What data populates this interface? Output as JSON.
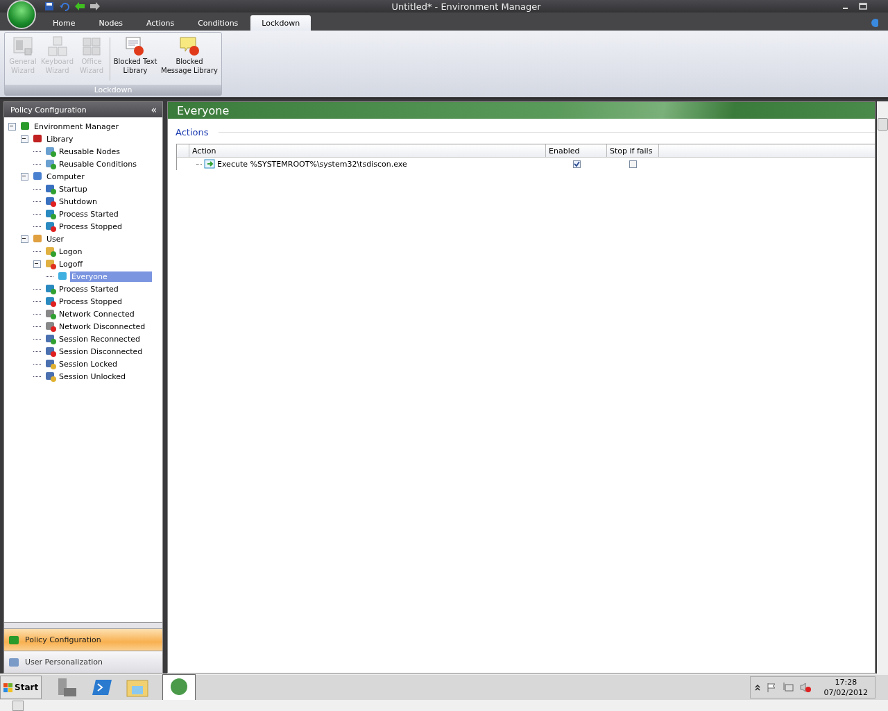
{
  "window": {
    "title": "Untitled* - Environment Manager"
  },
  "ribbon_tabs": [
    {
      "label": "Home",
      "selected": false
    },
    {
      "label": "Nodes",
      "selected": false
    },
    {
      "label": "Actions",
      "selected": false
    },
    {
      "label": "Conditions",
      "selected": false
    },
    {
      "label": "Lockdown",
      "selected": true
    }
  ],
  "ribbon_group": {
    "label": "Lockdown",
    "buttons": [
      {
        "label": "General Wizard",
        "disabled": true,
        "kind": "general"
      },
      {
        "label": "Keyboard Wizard",
        "disabled": true,
        "kind": "keyboard"
      },
      {
        "label": "Office Wizard",
        "disabled": true,
        "kind": "office"
      },
      {
        "label": "Blocked Text Library",
        "disabled": false,
        "kind": "text"
      },
      {
        "label": "Blocked Message Library",
        "disabled": false,
        "kind": "message"
      }
    ]
  },
  "sidebar": {
    "title": "Policy Configuration",
    "collapse": "«",
    "tree": [
      {
        "label": "Environment Manager",
        "kind": "root",
        "expanded": true,
        "selected": false,
        "children": [
          {
            "label": "Library",
            "kind": "library",
            "expanded": true,
            "selected": false,
            "children": [
              {
                "label": "Reusable Nodes",
                "kind": "reusable",
                "selected": false
              },
              {
                "label": "Reusable Conditions",
                "kind": "reusable",
                "selected": false
              }
            ]
          },
          {
            "label": "Computer",
            "kind": "computer",
            "expanded": true,
            "selected": false,
            "children": [
              {
                "label": "Startup",
                "kind": "startup",
                "selected": false
              },
              {
                "label": "Shutdown",
                "kind": "shutdown",
                "selected": false
              },
              {
                "label": "Process Started",
                "kind": "process-start",
                "selected": false
              },
              {
                "label": "Process Stopped",
                "kind": "process-stop",
                "selected": false
              }
            ]
          },
          {
            "label": "User",
            "kind": "user",
            "expanded": true,
            "selected": false,
            "children": [
              {
                "label": "Logon",
                "kind": "logon",
                "selected": false
              },
              {
                "label": "Logoff",
                "kind": "logoff",
                "expanded": true,
                "selected": false,
                "children": [
                  {
                    "label": "Everyone",
                    "kind": "group",
                    "selected": true
                  }
                ]
              },
              {
                "label": "Process Started",
                "kind": "process-start",
                "selected": false
              },
              {
                "label": "Process Stopped",
                "kind": "process-stop",
                "selected": false
              },
              {
                "label": "Network Connected",
                "kind": "net-on",
                "selected": false
              },
              {
                "label": "Network Disconnected",
                "kind": "net-off",
                "selected": false
              },
              {
                "label": "Session Reconnected",
                "kind": "session-on",
                "selected": false
              },
              {
                "label": "Session Disconnected",
                "kind": "session-off",
                "selected": false
              },
              {
                "label": "Session Locked",
                "kind": "session-lock",
                "selected": false
              },
              {
                "label": "Session Unlocked",
                "kind": "session-lock",
                "selected": false
              }
            ]
          }
        ]
      }
    ],
    "nav_buttons": [
      {
        "label": "Policy Configuration",
        "selected": true
      },
      {
        "label": "User Personalization",
        "selected": false
      }
    ]
  },
  "content": {
    "title": "Everyone",
    "section": "Actions",
    "table": {
      "columns": [
        "Action",
        "Enabled",
        "Stop if fails"
      ],
      "rows": [
        {
          "action": "Execute %SYSTEMROOT%\\system32\\tsdiscon.exe",
          "enabled": true,
          "stop_if_fails": false
        }
      ]
    }
  },
  "taskbar": {
    "start": "Start",
    "time": "17:28",
    "date": "07/02/2012"
  }
}
